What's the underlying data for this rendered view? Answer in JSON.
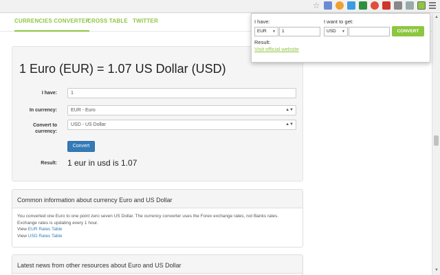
{
  "nav": {
    "tabs": [
      {
        "label": "CURRENCIES CONVERTER"
      },
      {
        "label": "CROSS TABLE"
      },
      {
        "label": "TWITTER"
      }
    ]
  },
  "main": {
    "title": "1 Euro (EUR) = 1.07 US Dollar (USD)",
    "i_have_label": "I have:",
    "i_have_value": "1",
    "in_currency_label": "In currency:",
    "in_currency_value": "EUR - Euro",
    "convert_to_label": "Convert to currency:",
    "convert_to_value": "USD - US Dollar",
    "convert_button": "Convert",
    "result_label": "Result:",
    "result_value": "1 eur in usd is 1.07"
  },
  "info": {
    "heading": "Common information about currency Euro and US Dollar",
    "body": "You converted one Euro to one point zero seven US Dollar. The currency converter uses the Forex exchange rates, not Banks rates. Exchange rates is updating every 1 hour.",
    "view_word": "View",
    "eur_link": "EUR Rates Table",
    "usd_link": "USD Rates Table"
  },
  "news": {
    "heading": "Latest news from other resources about Euro and US Dollar"
  },
  "popup": {
    "i_have_label": "I have:",
    "from_currency": "EUR",
    "amount": "1",
    "want_label": "I want to get:",
    "to_currency": "USD",
    "to_amount": "",
    "convert_button": "CONVERT",
    "result_label": "Result:",
    "link_text": "Visit official website"
  },
  "colors": {
    "accent_green": "#8dc63f",
    "button_blue": "#337ab7"
  }
}
